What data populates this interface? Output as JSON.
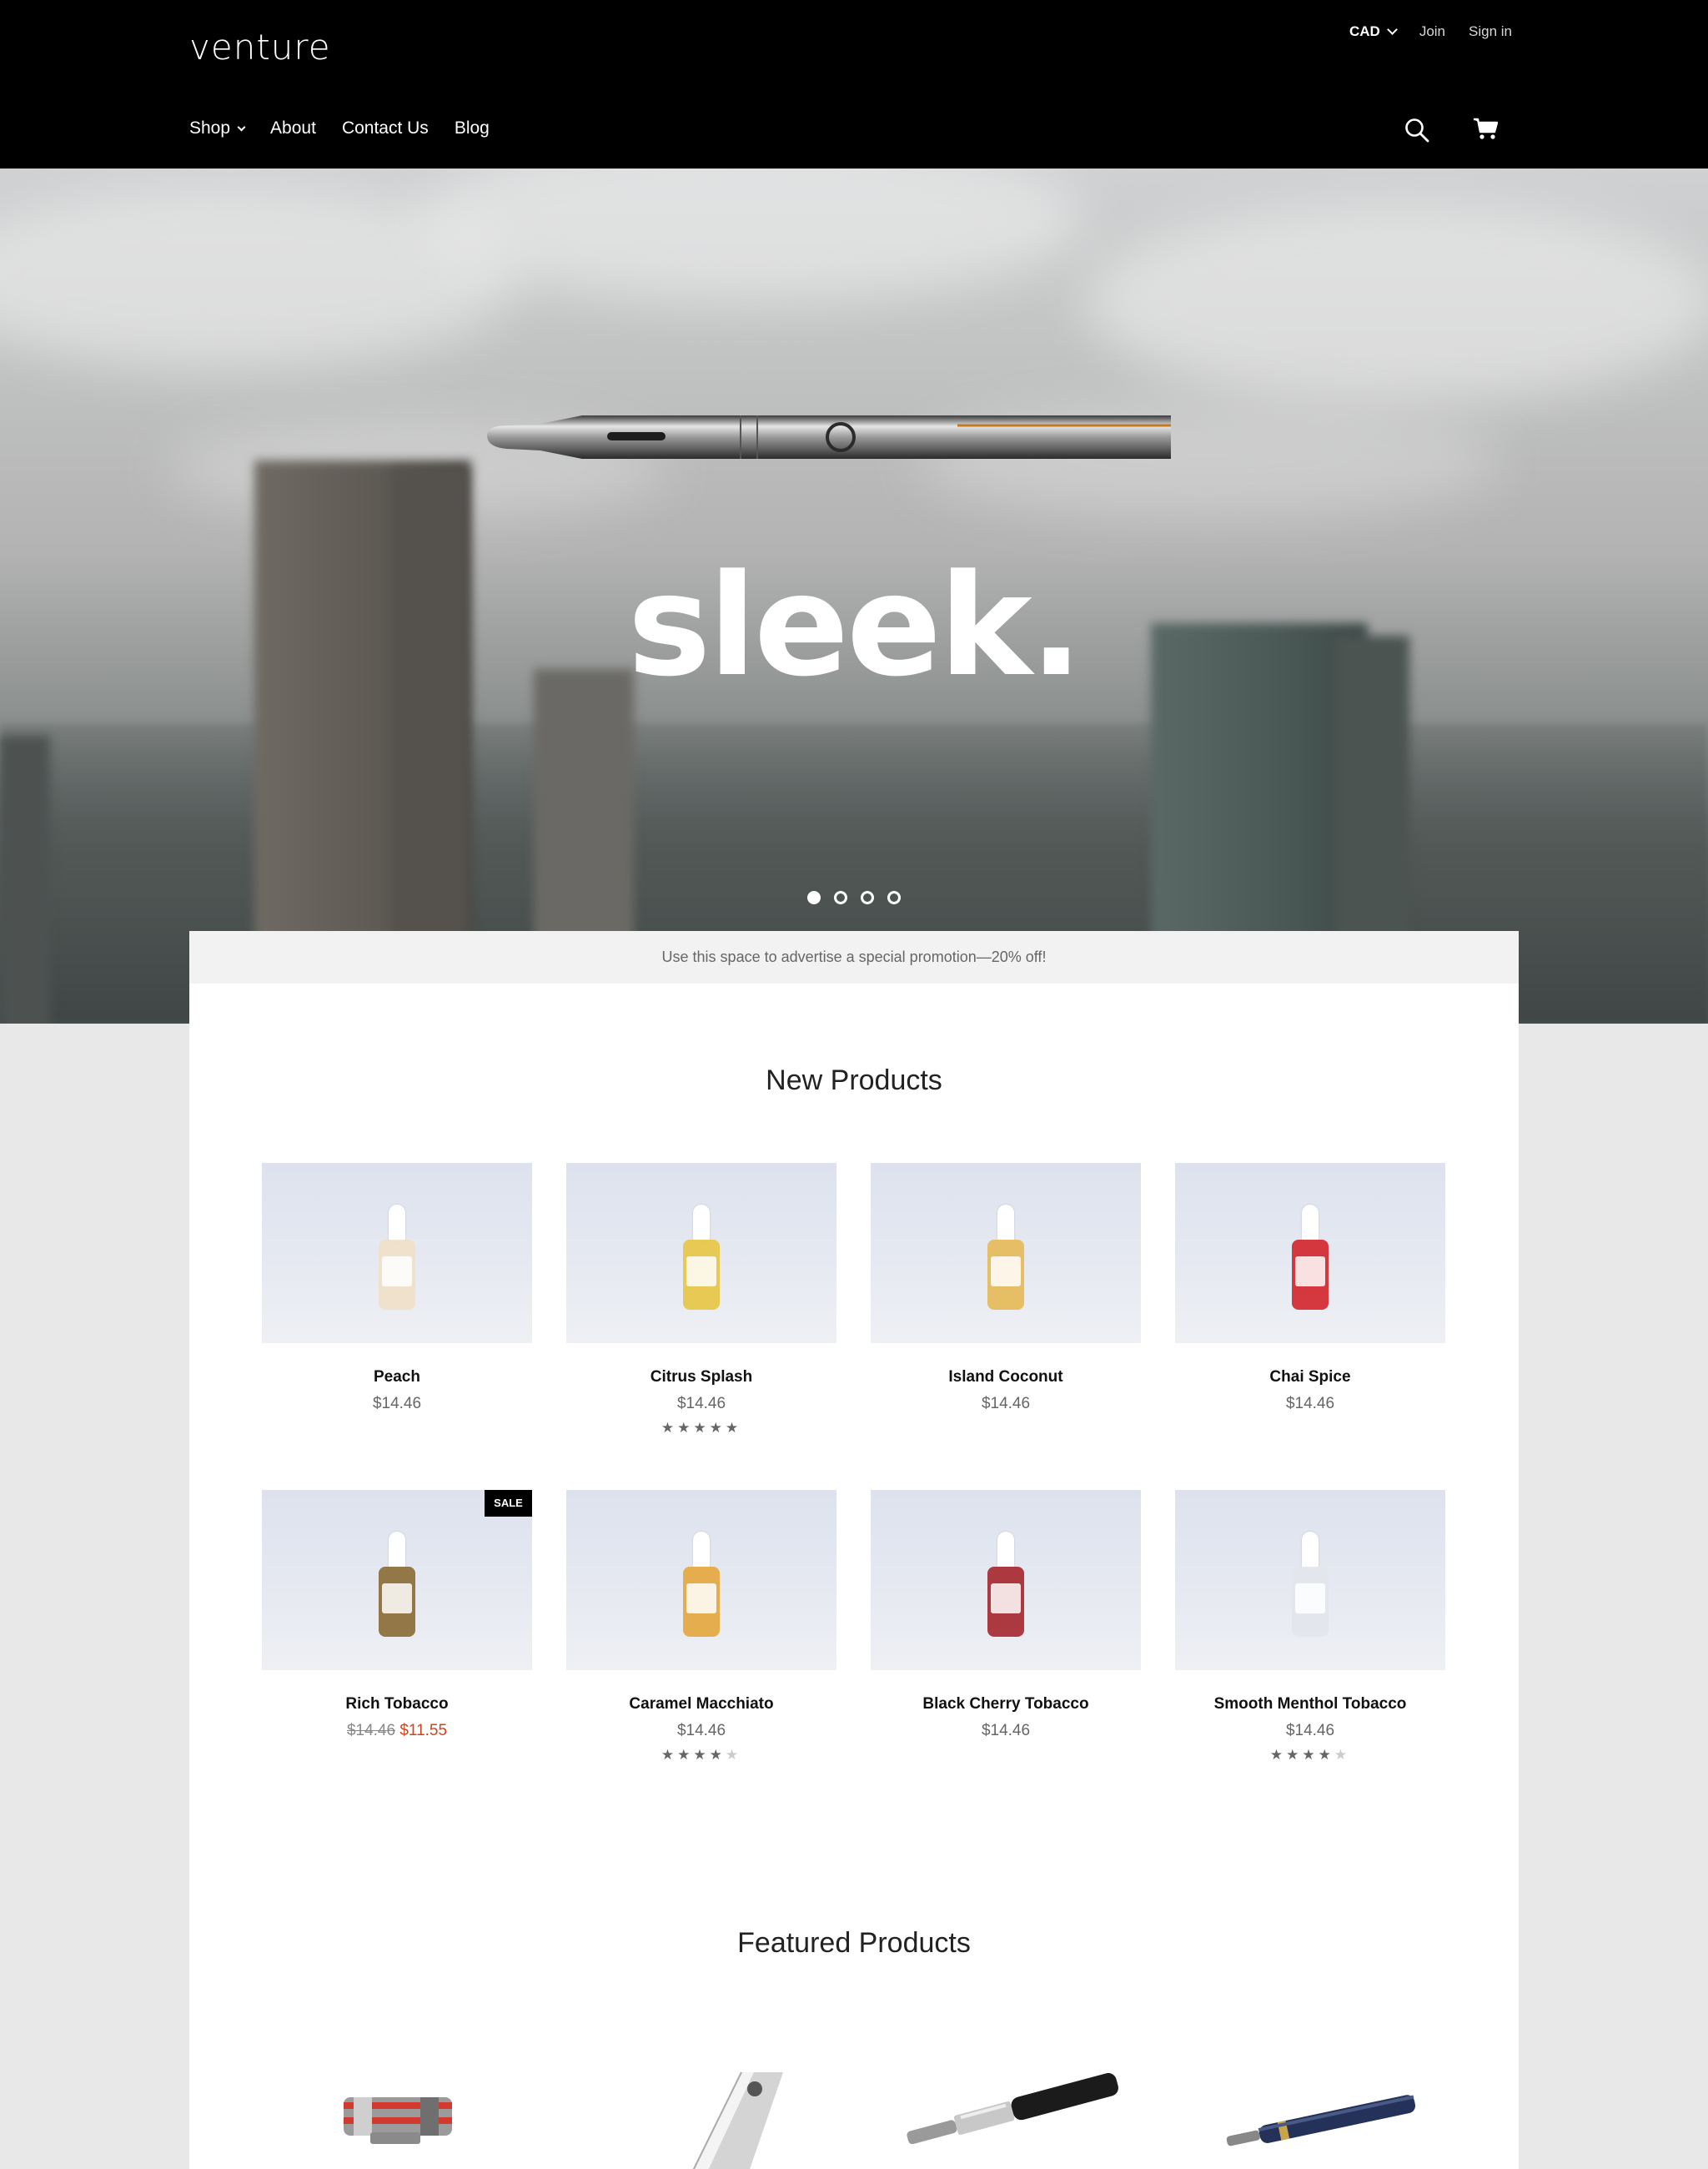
{
  "header": {
    "logo": "venture",
    "currency": "CAD",
    "join": "Join",
    "sign_in": "Sign in",
    "nav": [
      "Shop",
      "About",
      "Contact Us",
      "Blog"
    ]
  },
  "hero": {
    "title": "sleek.",
    "slides": 4,
    "active_slide": 1
  },
  "promo": "Use this space to advertise a special promotion—20% off!",
  "new_products": {
    "title": "New Products",
    "items": [
      {
        "name": "Peach",
        "price": "$14.46",
        "bottle_color": "#efe0c8"
      },
      {
        "name": "Citrus Splash",
        "price": "$14.46",
        "rating": 5,
        "bottle_color": "#e7c541"
      },
      {
        "name": "Island Coconut",
        "price": "$14.46",
        "bottle_color": "#e6b955"
      },
      {
        "name": "Chai Spice",
        "price": "$14.46",
        "bottle_color": "#d3242a"
      },
      {
        "name": "Rich Tobacco",
        "old_price": "$14.46",
        "sale_price": "$11.55",
        "badge": "SALE",
        "bottle_color": "#8a6a34"
      },
      {
        "name": "Caramel Macchiato",
        "price": "$14.46",
        "rating": 4,
        "bottle_color": "#e4a63b"
      },
      {
        "name": "Black Cherry Tobacco",
        "price": "$14.46",
        "bottle_color": "#a5262c"
      },
      {
        "name": "Smooth Menthol Tobacco",
        "price": "$14.46",
        "rating": 4,
        "bottle_color": "#e3e5ec"
      }
    ]
  },
  "featured_products": {
    "title": "Featured Products"
  },
  "colors": {
    "header_bg": "#000000",
    "sale_red": "#d0421b",
    "page_bg": "#e9e8e8",
    "promo_bg": "#f2f2f2"
  },
  "icons": [
    "search-icon",
    "cart-icon",
    "chevron-down-icon",
    "star-icon"
  ]
}
